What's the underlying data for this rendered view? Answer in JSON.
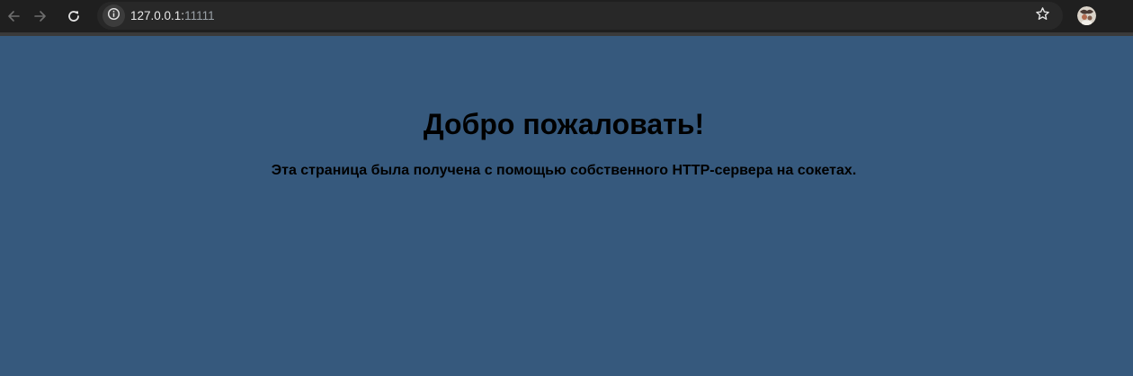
{
  "browser": {
    "url_host": "127.0.0.1:",
    "url_port": "11111",
    "icons": {
      "back": "arrow-left-icon",
      "forward": "arrow-right-icon",
      "reload": "reload-icon",
      "site_info": "info-icon",
      "bookmark": "star-icon",
      "profile": "avatar"
    }
  },
  "page": {
    "title": "Добро пожаловать!",
    "text": "Эта страница была получена с помощью собственного HTTP-сервера на сокетах.",
    "background_color": "#36597d",
    "text_color": "#000000"
  }
}
